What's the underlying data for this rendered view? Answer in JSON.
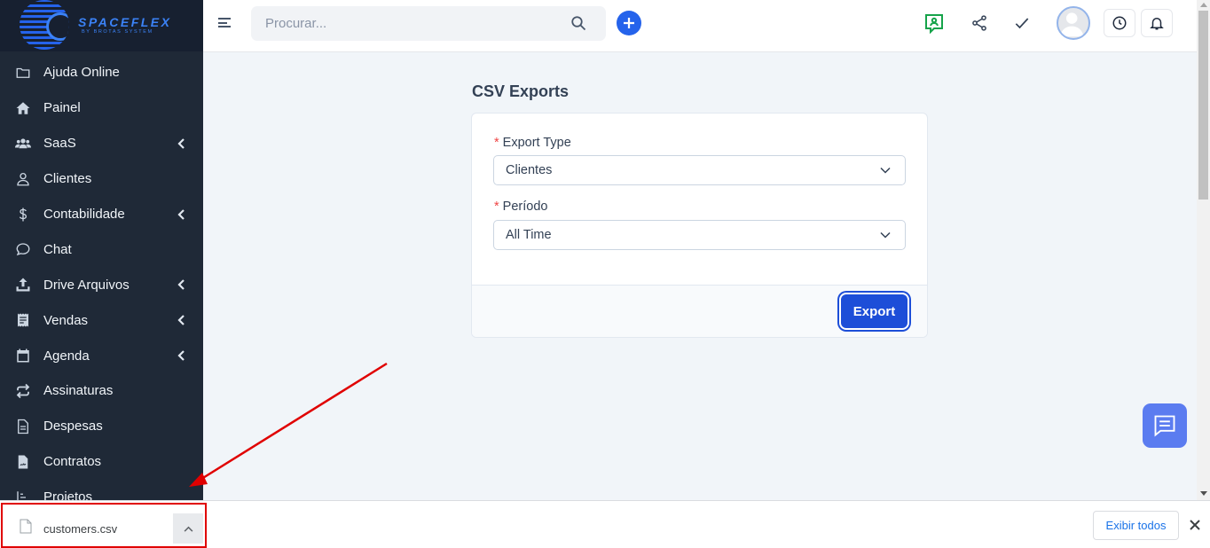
{
  "brand": {
    "name": "SPACEFLEX",
    "tagline": "BY BROTAS SYSTEM",
    "logo_icon": "spaceflex-logo"
  },
  "sidebar": {
    "items": [
      {
        "label": "Ajuda Online",
        "icon": "folder-icon",
        "has_submenu": false
      },
      {
        "label": "Painel",
        "icon": "home-icon",
        "has_submenu": false
      },
      {
        "label": "SaaS",
        "icon": "users-icon",
        "has_submenu": true
      },
      {
        "label": "Clientes",
        "icon": "user-icon",
        "has_submenu": false
      },
      {
        "label": "Contabilidade",
        "icon": "dollar-icon",
        "has_submenu": true
      },
      {
        "label": "Chat",
        "icon": "chat-bubble-icon",
        "has_submenu": false
      },
      {
        "label": "Drive Arquivos",
        "icon": "upload-icon",
        "has_submenu": true
      },
      {
        "label": "Vendas",
        "icon": "receipt-icon",
        "has_submenu": true
      },
      {
        "label": "Agenda",
        "icon": "calendar-icon",
        "has_submenu": true
      },
      {
        "label": "Assinaturas",
        "icon": "repeat-icon",
        "has_submenu": false
      },
      {
        "label": "Despesas",
        "icon": "document-icon",
        "has_submenu": false
      },
      {
        "label": "Contratos",
        "icon": "contract-icon",
        "has_submenu": false
      },
      {
        "label": "Projetos",
        "icon": "chart-icon",
        "has_submenu": false
      }
    ]
  },
  "header": {
    "search_placeholder": "Procurar...",
    "icons": [
      "menu-icon",
      "search-icon",
      "add-icon",
      "support-chat-icon",
      "share-icon",
      "check-icon",
      "avatar",
      "clock-icon",
      "bell-icon"
    ]
  },
  "main": {
    "title": "CSV Exports",
    "fields": [
      {
        "label": "Export Type",
        "required": "*",
        "value": "Clientes"
      },
      {
        "label": "Período",
        "required": "*",
        "value": "All Time"
      }
    ],
    "export_button": "Export"
  },
  "download_bar": {
    "file_name": "customers.csv",
    "show_all_label": "Exibir todos"
  },
  "colors": {
    "sidebar_bg": "#1f2937",
    "accent": "#2563eb",
    "export_button": "#1d4ed8",
    "annotation": "#e00000"
  }
}
